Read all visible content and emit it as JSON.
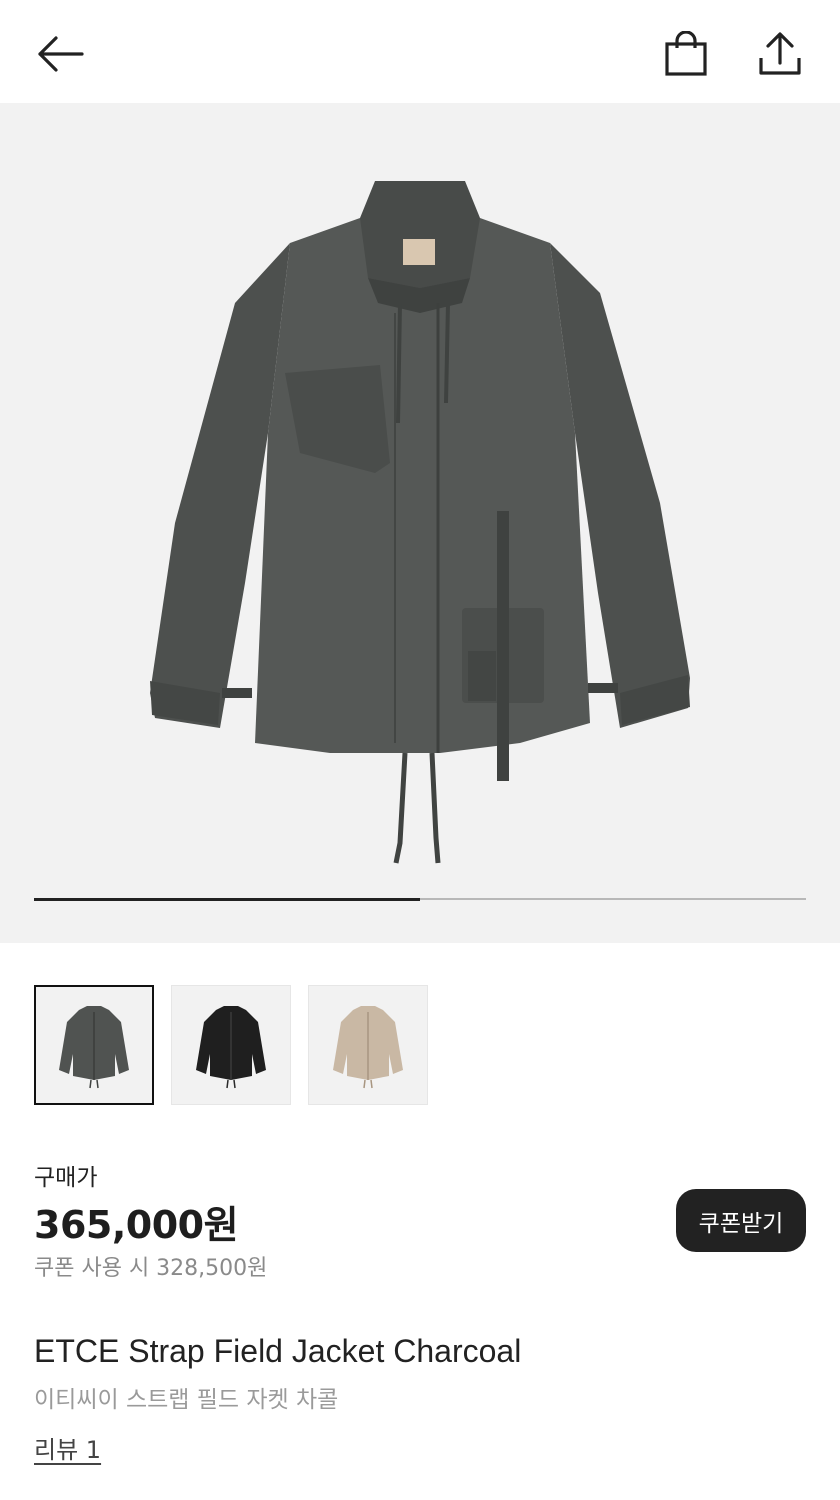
{
  "header": {
    "back_icon": "arrow-left-icon",
    "bag_icon": "shopping-bag-icon",
    "share_icon": "share-upload-icon"
  },
  "gallery": {
    "progress": 0.5,
    "thumbnails": [
      {
        "color": "charcoal",
        "selected": true
      },
      {
        "color": "black",
        "selected": false
      },
      {
        "color": "beige",
        "selected": false
      }
    ]
  },
  "pricing": {
    "label": "구매가",
    "price": "365,000원",
    "coupon_price": "쿠폰 사용 시 328,500원",
    "coupon_button": "쿠폰받기"
  },
  "product": {
    "name_en": "ETCE Strap Field Jacket Charcoal",
    "name_ko": "이티씨이 스트랩 필드 자켓 차콜",
    "review_link": "리뷰 1"
  },
  "colors": {
    "charcoal": "#4f5250",
    "black": "#1f1f1f",
    "beige": "#c9b8a4",
    "button_dark": "#222222"
  }
}
